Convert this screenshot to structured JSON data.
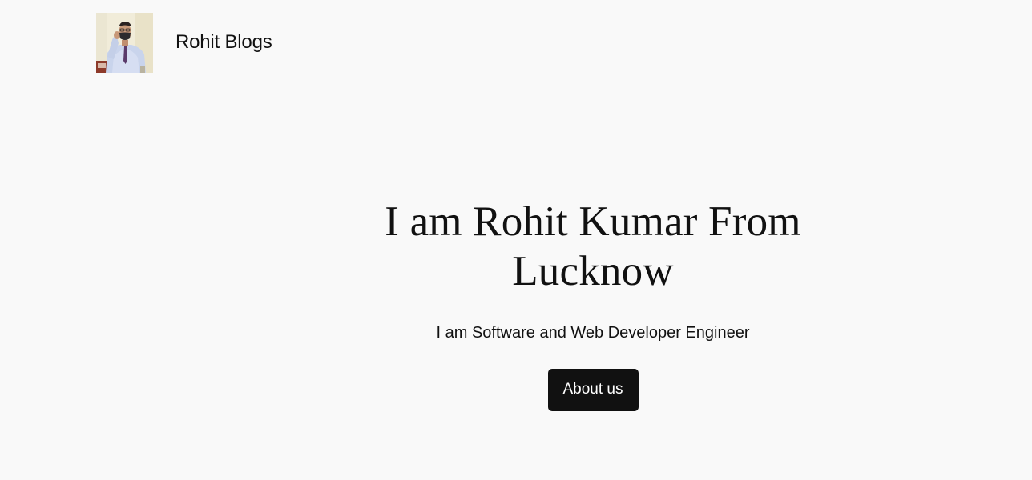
{
  "header": {
    "site_title": "Rohit Blogs",
    "logo_alt": "Rohit Blogs"
  },
  "hero": {
    "title": "I am Rohit Kumar From Lucknow",
    "subtitle": "I am Software and Web Developer Engineer",
    "cta_label": "About us"
  },
  "colors": {
    "background": "#f9f9f9",
    "text": "#111111",
    "button_bg": "#111111",
    "button_text": "#ffffff"
  }
}
